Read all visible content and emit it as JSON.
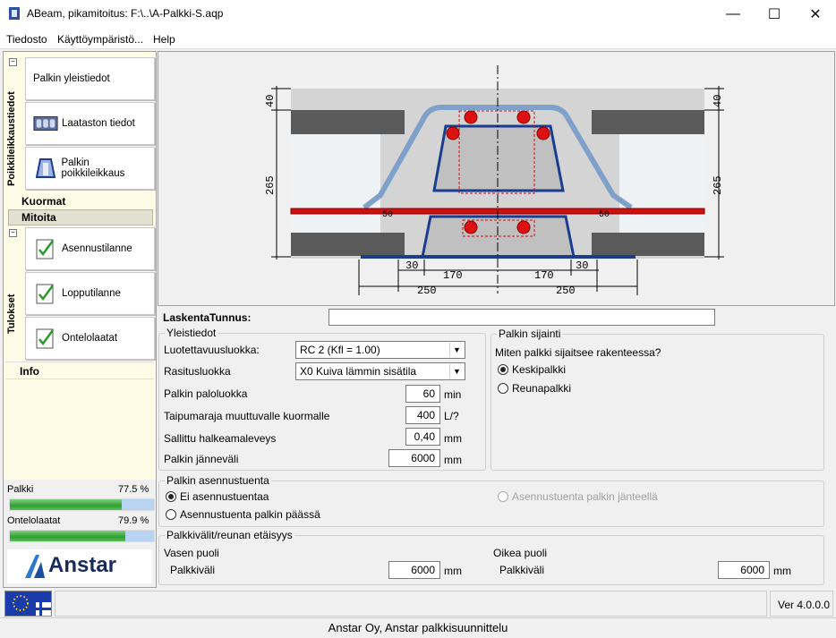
{
  "window": {
    "title": "ABeam, pikamitoitus:  F:\\..\\A-Palkki-S.aqp"
  },
  "menu": {
    "items": [
      "Tiedosto",
      "Käyttöympäristö...",
      "Help"
    ]
  },
  "sidebar": {
    "group1_label": "Poikkileikkaustiedot",
    "nav1": [
      "Palkin yleistiedot",
      "Laataston tiedot",
      "Palkin poikkileikkaus"
    ],
    "kuormat": "Kuormat",
    "mitoita": "Mitoita",
    "group2_label": "Tulokset",
    "nav2": [
      "Asennustilanne",
      "Lopputilanne",
      "Ontelolaatat"
    ],
    "info": "Info",
    "usage": [
      {
        "label": "Palkki",
        "value": "77.5 %",
        "fraction": 0.775
      },
      {
        "label": "Ontelolaatat",
        "value": "79.9 %",
        "fraction": 0.799
      }
    ],
    "logo_text": "Anstar"
  },
  "drawing": {
    "dims": {
      "top_left": "40",
      "top_right": "40",
      "height_left": "265",
      "height_right": "265",
      "d30a": "30",
      "d30b": "30",
      "d170a": "170",
      "d170b": "170",
      "d250a": "250",
      "d250b": "250",
      "s50a": "50",
      "s50b": "50"
    }
  },
  "form": {
    "laskenta_label": "LaskentaTunnus:",
    "laskenta_value": "",
    "yleistiedot": {
      "title": "Yleistiedot",
      "luotettavuus_label": "Luotettavuusluokka:",
      "luotettavuus_value": "RC 2  (Kfl = 1.00)",
      "rasitus_label": "Rasitusluokka",
      "rasitus_value": "X0  Kuiva lämmin sisätila",
      "palo_label": "Palkin paloluokka",
      "palo_value": "60",
      "palo_unit": "min",
      "taipuma_label": "Taipumaraja muuttuvalle kuormalle",
      "taipuma_value": "400",
      "taipuma_unit": "L/?",
      "halkeama_label": "Sallittu halkeamaleveys",
      "halkeama_value": "0,40",
      "halkeama_unit": "mm",
      "janneväli_label": "Palkin jänneväli",
      "janneväli_value": "6000",
      "janneväli_unit": "mm"
    },
    "sijainti": {
      "title": "Palkin sijainti",
      "question": "Miten palkki sijaitsee rakenteessa?",
      "options": [
        "Keskipalkki",
        "Reunapalkki"
      ],
      "selected": "Keskipalkki"
    },
    "asennustuenta": {
      "title": "Palkin asennustuenta",
      "options": [
        "Ei asennustuentaa",
        "Asennustuenta palkin päässä",
        "Asennustuenta palkin jänteellä"
      ],
      "selected": "Ei asennustuentaa"
    },
    "palkkivalit": {
      "title": "Palkkivälit/reunan etäisyys",
      "left_title": "Vasen puoli",
      "left_label": "Palkkiväli",
      "left_value": "6000",
      "left_unit": "mm",
      "right_title": "Oikea puoli",
      "right_label": "Palkkiväli",
      "right_value": "6000",
      "right_unit": "mm"
    }
  },
  "status": {
    "version": "Ver 4.0.0.0"
  },
  "footer": {
    "text": "Anstar Oy,  Anstar palkkisuunnittelu"
  },
  "colors": {
    "accent_blue": "#1a3d8f",
    "rebar_red": "#cc1111",
    "bar_blue": "#b8d4f0",
    "bar_green": "#2ea02e"
  }
}
